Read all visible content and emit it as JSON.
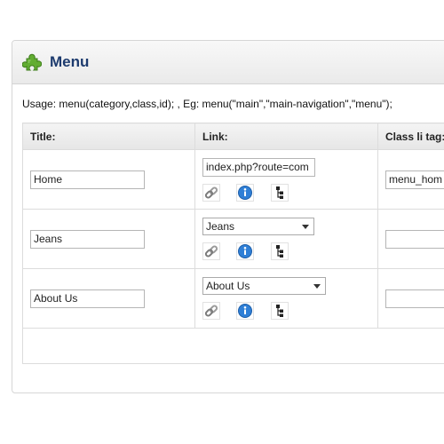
{
  "header": {
    "title": "Menu",
    "icon": "puzzle-piece-icon",
    "icon_color": "#5aa02c",
    "title_color": "#1d3b6e"
  },
  "usage": "Usage: menu(category,class,id); , Eg: menu(\"main\",\"main-navigation\",\"menu\");",
  "table": {
    "columns": [
      "Title:",
      "Link:",
      "Class li tag:"
    ],
    "rows": [
      {
        "title": "Home",
        "link_type": "input",
        "link": "index.php?route=com",
        "class_value": "menu_hom",
        "icons": [
          "chain-link-icon",
          "info-icon",
          "tree-icon"
        ]
      },
      {
        "title": "Jeans",
        "link_type": "select",
        "link": "Jeans",
        "class_value": "",
        "icons": [
          "chain-link-icon",
          "info-icon",
          "tree-icon"
        ]
      },
      {
        "title": "About Us",
        "link_type": "select",
        "link": "About Us",
        "class_value": "",
        "icons": [
          "chain-link-icon",
          "info-icon",
          "tree-icon"
        ]
      }
    ]
  }
}
